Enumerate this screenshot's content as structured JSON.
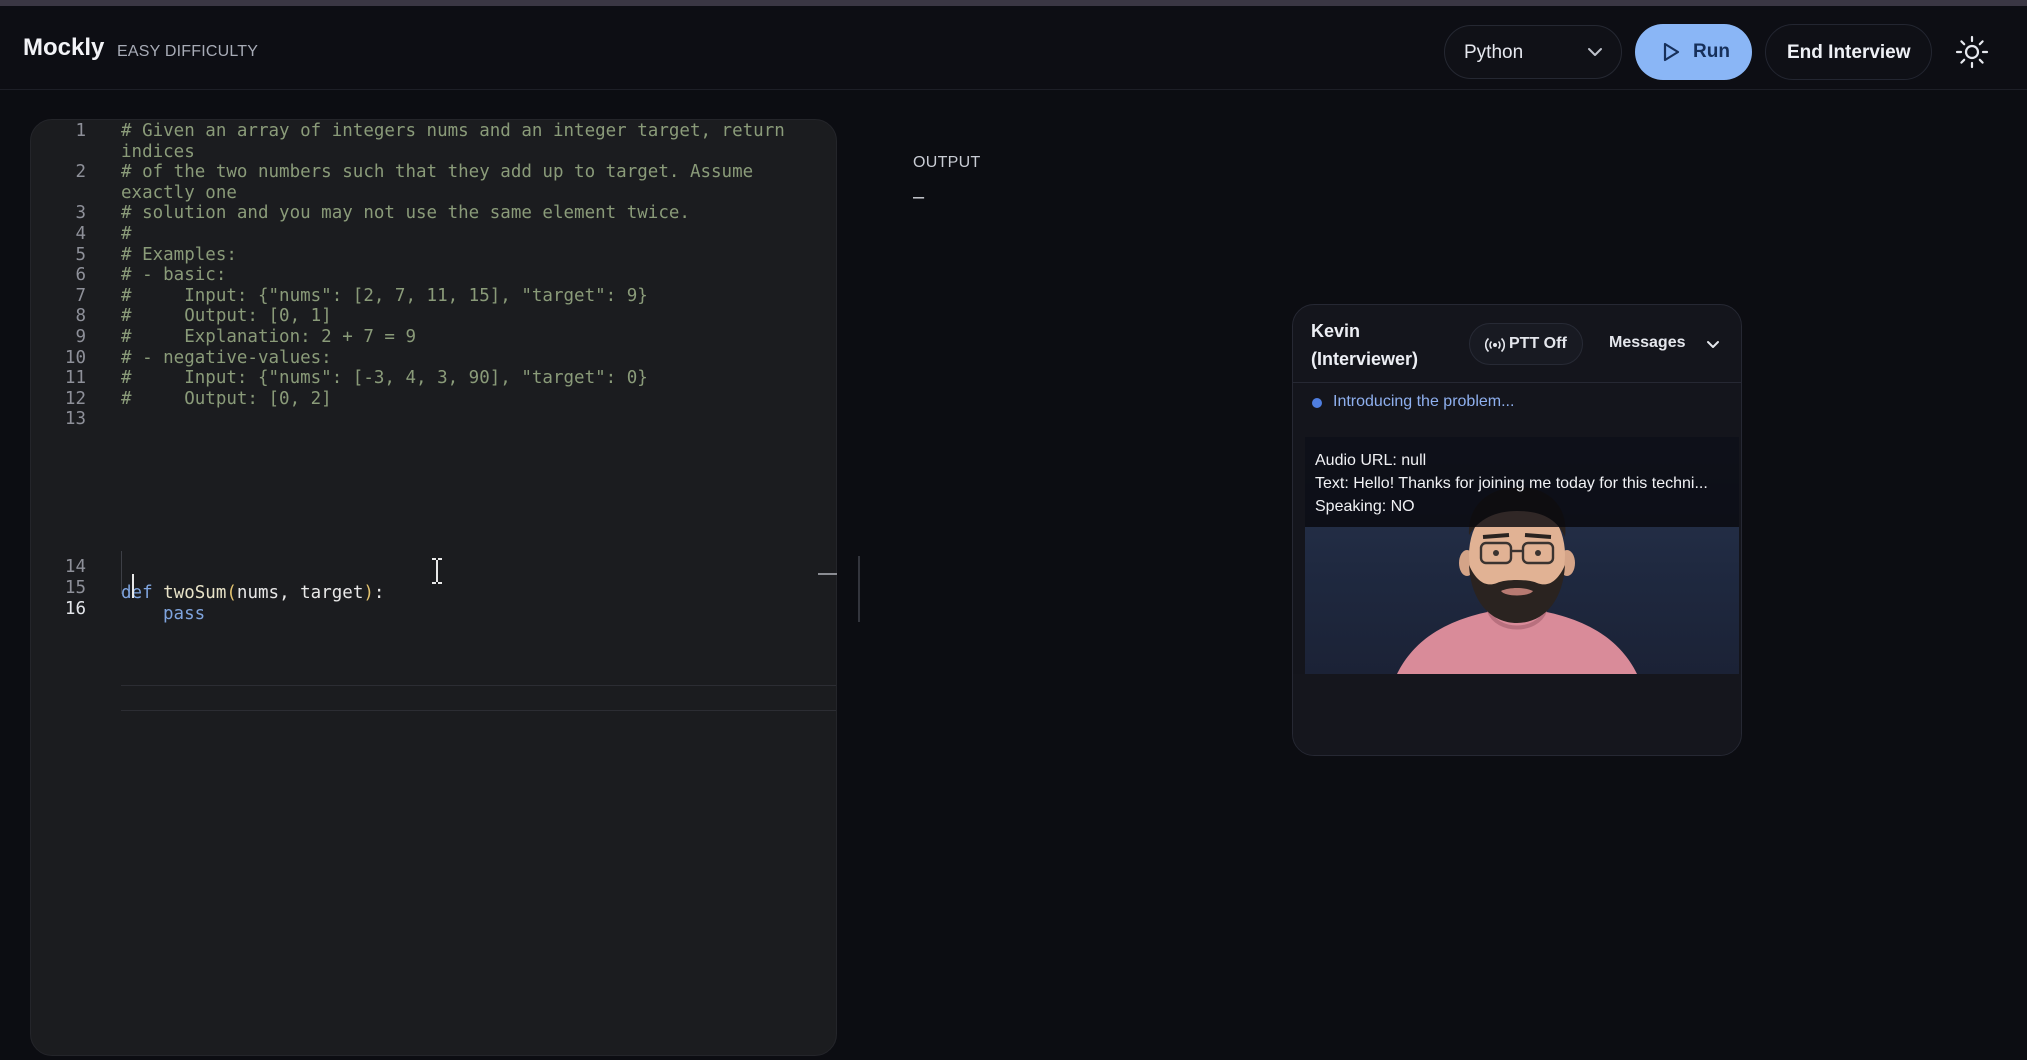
{
  "header": {
    "brand": "Mockly",
    "difficulty": "EASY DIFFICULTY",
    "language": "Python",
    "run_label": "Run",
    "end_label": "End Interview"
  },
  "editor": {
    "lines": [
      {
        "n": "1",
        "text": "# Given an array of integers nums and an integer target, return"
      },
      {
        "n": "",
        "text": "indices"
      },
      {
        "n": "2",
        "text": "# of the two numbers such that they add up to target. Assume"
      },
      {
        "n": "",
        "text": "exactly one"
      },
      {
        "n": "3",
        "text": "# solution and you may not use the same element twice."
      },
      {
        "n": "4",
        "text": "#"
      },
      {
        "n": "5",
        "text": "# Examples:"
      },
      {
        "n": "6",
        "text": "# - basic:"
      },
      {
        "n": "7",
        "text": "#     Input: {\"nums\": [2, 7, 11, 15], \"target\": 9}"
      },
      {
        "n": "8",
        "text": "#     Output: [0, 1]"
      },
      {
        "n": "9",
        "text": "#     Explanation: 2 + 7 = 9"
      },
      {
        "n": "10",
        "text": "# - negative-values:"
      },
      {
        "n": "11",
        "text": "#     Input: {\"nums\": [-3, 4, 3, 90], \"target\": 0}"
      },
      {
        "n": "12",
        "text": "#     Output: [0, 2]"
      },
      {
        "n": "13",
        "text": ""
      }
    ],
    "line14": {
      "n": "14",
      "kw": "def",
      "name": "twoSum",
      "open": "(",
      "args": "nums, target",
      "close": ")",
      "colon": ":"
    },
    "line15": {
      "n": "15",
      "text": "pass"
    },
    "line16": {
      "n": "16"
    }
  },
  "output": {
    "label": "OUTPUT",
    "value": "–"
  },
  "interviewer": {
    "name_line1": "Kevin",
    "name_line2": "(Interviewer)",
    "ptt_label": "PTT Off",
    "messages_label": "Messages",
    "status": "Introducing the problem...",
    "debug": {
      "audio": "Audio URL: null",
      "text": "Text: Hello! Thanks for joining me today for this techni...",
      "speaking": "Speaking: NO"
    }
  },
  "colors": {
    "accent": "#8ab6f6",
    "background": "#0c0d12",
    "editor_bg": "#1b1c1f",
    "comment": "#8a9b79",
    "keyword": "#7fa4de",
    "status": "#4f7ee0"
  },
  "icons": [
    "chevron-down-icon",
    "play-icon",
    "sun-icon",
    "broadcast-icon",
    "text-cursor-icon"
  ]
}
